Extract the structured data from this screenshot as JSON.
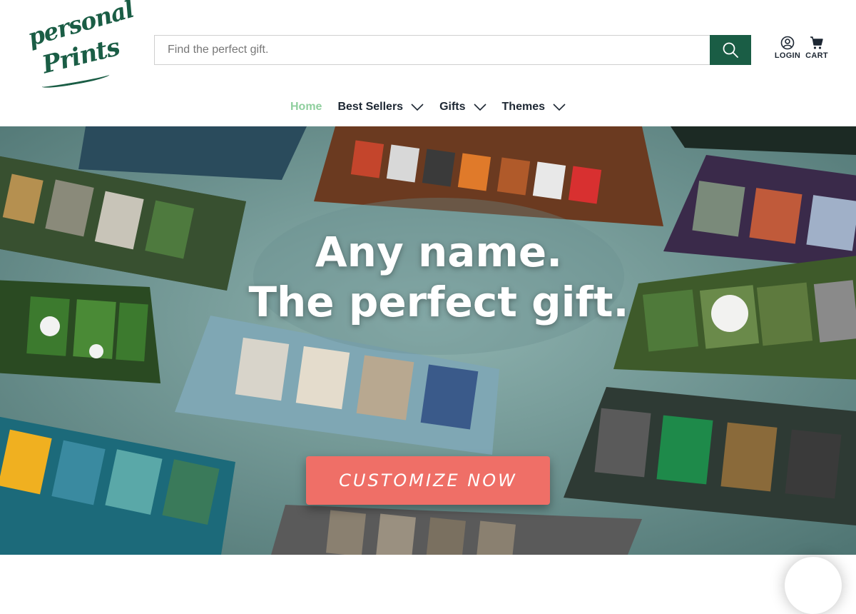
{
  "brand": {
    "logo_line1": "personal",
    "logo_line2": "Prints",
    "color": "#1a5d45"
  },
  "search": {
    "placeholder": "Find the perfect gift.",
    "value": "",
    "button_icon": "search-icon",
    "button_color": "#1a5d45"
  },
  "account": {
    "login_label": "LOGIN",
    "login_icon": "user-icon",
    "cart_label": "CART",
    "cart_icon": "cart-icon"
  },
  "nav": {
    "active_color": "#8fcf9e",
    "items": [
      {
        "label": "Home",
        "active": true,
        "dropdown": false
      },
      {
        "label": "Best Sellers",
        "active": false,
        "dropdown": true
      },
      {
        "label": "Gifts",
        "active": false,
        "dropdown": true
      },
      {
        "label": "Themes",
        "active": false,
        "dropdown": true
      }
    ]
  },
  "hero": {
    "headline_line1": "Any name.",
    "headline_line2": "The perfect gift.",
    "cta_label": "CUSTOMIZE NOW",
    "cta_color": "#ef6f67",
    "background_color": "#6a8f8f"
  }
}
